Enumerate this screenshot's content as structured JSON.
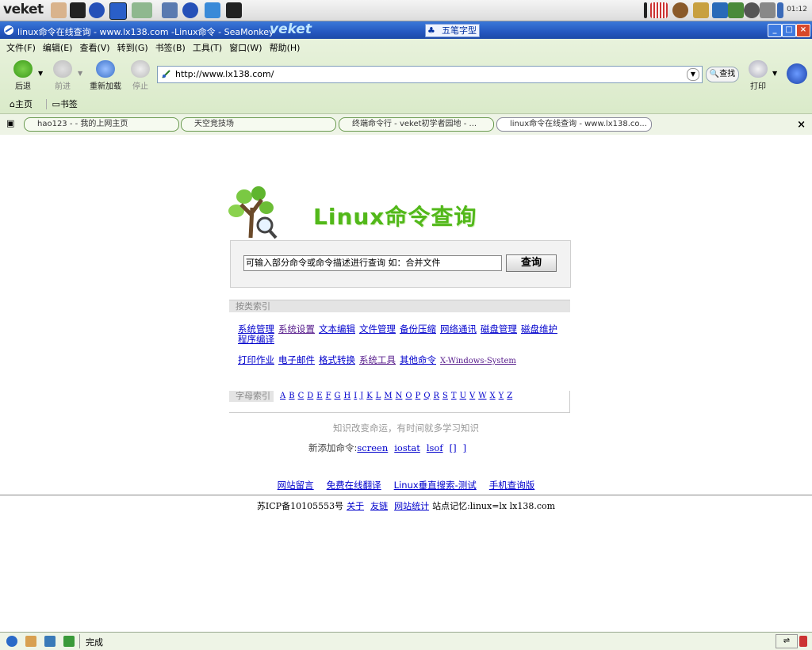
{
  "taskbar": {
    "logo": "veket",
    "clock": "01:12"
  },
  "window": {
    "title": "linux命令在线查询 - www.lx138.com -Linux命令 - SeaMonkey",
    "brand": "veket",
    "ime": "五笔字型"
  },
  "menu": [
    "文件(F)",
    "编辑(E)",
    "查看(V)",
    "转到(G)",
    "书签(B)",
    "工具(T)",
    "窗口(W)",
    "帮助(H)"
  ],
  "nav": {
    "back": "后退",
    "forward": "前进",
    "reload": "重新加载",
    "stop": "停止",
    "print": "打印"
  },
  "address": {
    "url": "http://www.lx138.com/",
    "search_label": "查找"
  },
  "bookmarks": {
    "home": "主页",
    "bookmarks": "书签"
  },
  "tabs": [
    "hao123 - - 我的上网主页",
    "天空竞技场",
    "终端命令行 - veket初学者园地 - ...",
    "linux命令在线查询 - www.lx138.co..."
  ],
  "page": {
    "brand_title": "Linux命令查询",
    "search_value": "可输入部分命令或命令描述进行查询 如：合并文件",
    "search_button": "查询",
    "category_header": "按类索引",
    "categories_row1": [
      "系统管理",
      "系统设置",
      "文本编辑",
      "文件管理",
      "备份压缩",
      "网络通讯",
      "磁盘管理",
      "磁盘维护",
      "程序编译"
    ],
    "categories_row2": [
      "打印作业",
      "电子邮件",
      "格式转换",
      "系统工具",
      "其他命令",
      "X-Windows-System"
    ],
    "letters_label": "字母索引",
    "letters": [
      "A",
      "B",
      "C",
      "D",
      "E",
      "F",
      "G",
      "H",
      "I",
      "J",
      "K",
      "L",
      "M",
      "N",
      "O",
      "P",
      "Q",
      "R",
      "S",
      "T",
      "U",
      "V",
      "W",
      "X",
      "Y",
      "Z"
    ],
    "motto": "知识改变命运，有时间就多学习知识",
    "new_label": "新添加命令:",
    "new_commands": [
      "screen",
      "iostat",
      "lsof",
      "[]",
      "]"
    ],
    "footer_links": [
      "网站留言",
      "免费在线翻译",
      "Linux垂直搜索-测试",
      "手机查询版"
    ],
    "icp": "苏ICP备10105553号",
    "icp_links": [
      "关于",
      "友链",
      "网站统计"
    ],
    "site_memo": "站点记忆:linux=lx lx138.com"
  },
  "status": {
    "text": "完成"
  }
}
